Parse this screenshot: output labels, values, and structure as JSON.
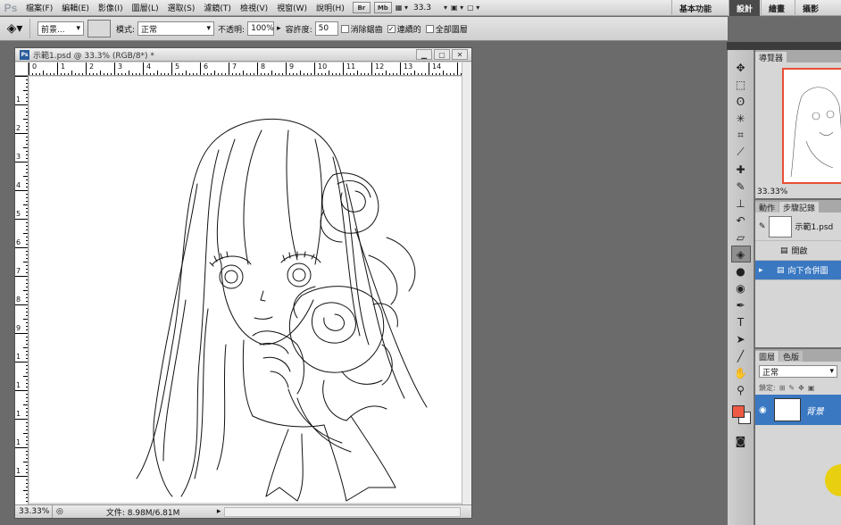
{
  "menubar": {
    "logo": "Ps",
    "items": [
      "檔案(F)",
      "編輯(E)",
      "影像(I)",
      "圖層(L)",
      "選取(S)",
      "濾鏡(T)",
      "檢視(V)",
      "視窗(W)",
      "說明(H)"
    ],
    "app_buttons": [
      "Br",
      "Mb"
    ],
    "zoom": "33.3",
    "workspaces": [
      "基本功能",
      "設計",
      "繪畫",
      "攝影"
    ],
    "active_workspace": "設計"
  },
  "options": {
    "fill_source": "前景...",
    "mode_label": "模式:",
    "mode_value": "正常",
    "opacity_label": "不透明:",
    "opacity_value": "100%",
    "tolerance_label": "容許度:",
    "tolerance_value": "50",
    "antialias_label": "消除鋸齒",
    "contiguous_label": "連續的",
    "all_layers_label": "全部圖層"
  },
  "document": {
    "title": "示範1.psd @ 33.3% (RGB/8*) *",
    "ruler_top": [
      "0",
      "1",
      "2",
      "3",
      "4",
      "5",
      "6",
      "7",
      "8",
      "9",
      "10",
      "11",
      "12",
      "13",
      "14"
    ],
    "ruler_left": [
      "1",
      "2",
      "3",
      "4",
      "5",
      "6",
      "7",
      "8",
      "9",
      "1",
      "1",
      "1",
      "1",
      "1"
    ],
    "status_zoom": "33.33%",
    "status_info": "文件: 8.98M/6.81M"
  },
  "navigator": {
    "tab": "導覽器",
    "zoom": "33.33%"
  },
  "history": {
    "tabs": [
      "動作",
      "步驟記錄"
    ],
    "snapshot": "示範1.psd",
    "steps": [
      "開啟",
      "向下合併圖"
    ]
  },
  "layers": {
    "tabs": [
      "圖層",
      "色版"
    ],
    "blend_mode": "正常",
    "lock_label": "鎖定:",
    "layer_name": "背景"
  },
  "colors": {
    "foreground": "#ef5a44",
    "background": "#ffffff",
    "accent": "#3a78c2"
  }
}
